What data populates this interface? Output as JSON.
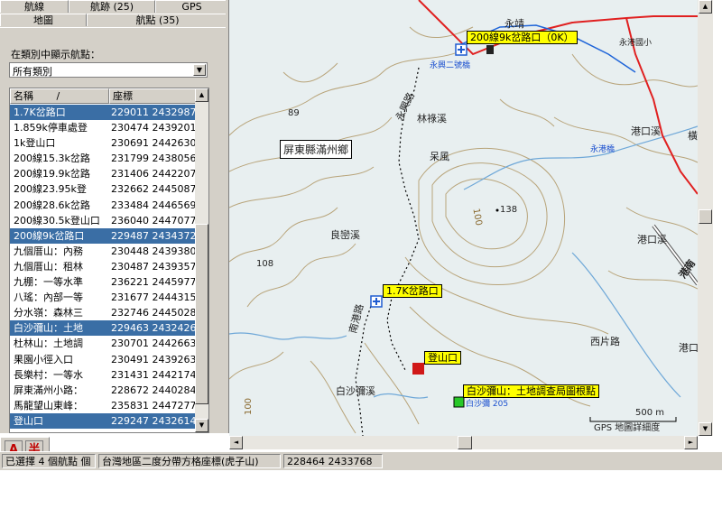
{
  "tabs_row1": [
    "航線",
    "航跡 (25)",
    "GPS"
  ],
  "tabs_row2": [
    "地圖",
    "航點 (35)"
  ],
  "filter": {
    "label": "在類別中顯示航點：",
    "selected": "所有類別"
  },
  "list": {
    "headers": [
      "名稱",
      "座標"
    ],
    "rows": [
      {
        "name": "1.7K岔路口",
        "coord": "229011 2432987",
        "selected": true
      },
      {
        "name": "1.859k停車處登",
        "coord": "230474 2439201",
        "selected": false
      },
      {
        "name": "1k登山口",
        "coord": "230691 2442630",
        "selected": false
      },
      {
        "name": "200線15.3k岔路",
        "coord": "231799 2438056",
        "selected": false
      },
      {
        "name": "200線19.9k岔路",
        "coord": "231406 2442207",
        "selected": false
      },
      {
        "name": "200線23.95k登",
        "coord": "232662 2445087",
        "selected": false
      },
      {
        "name": "200線28.6k岔路",
        "coord": "233484 2446569",
        "selected": false
      },
      {
        "name": "200線30.5k登山口",
        "coord": "236040 2447077",
        "selected": false
      },
      {
        "name": "200線9k岔路口",
        "coord": "229487 2434372",
        "selected": true
      },
      {
        "name": "九個厝山：內務",
        "coord": "230448 2439380",
        "selected": false
      },
      {
        "name": "九個厝山：租林",
        "coord": "230487 2439357",
        "selected": false
      },
      {
        "name": "九棚：一等水準",
        "coord": "236221 2445977",
        "selected": false
      },
      {
        "name": "八瑤：內部一等",
        "coord": "231677 2444315",
        "selected": false
      },
      {
        "name": "分水嶺：森林三",
        "coord": "232746 2445028",
        "selected": false
      },
      {
        "name": "白沙彌山：土地",
        "coord": "229463 2432426",
        "selected": true
      },
      {
        "name": "杜林山：土地調",
        "coord": "230701 2442663",
        "selected": false
      },
      {
        "name": "果園小徑入口",
        "coord": "230491 2439263",
        "selected": false
      },
      {
        "name": "長樂村：一等水",
        "coord": "231431 2442174",
        "selected": false
      },
      {
        "name": "屏東滿州小路：",
        "coord": "228672 2440284",
        "selected": false
      },
      {
        "name": "馬龍望山東峰：",
        "coord": "235831 2447277",
        "selected": false
      },
      {
        "name": "登山口",
        "coord": "229247 2432614",
        "selected": true
      }
    ]
  },
  "map": {
    "labels": {
      "yongjing": "永靖",
      "yongjing_school": "永港國小",
      "yongxing_bridge": "永興二號橋",
      "yonggang_bridge": "永港橋",
      "yongjing_bridge": "永港橋",
      "linxi": "林祿溪",
      "gangkouxi": "港口溪",
      "gangkouxi2": "港口溪",
      "gangkou": "港口",
      "xipian": "西片路",
      "pingdong": "屏東縣滿州鄉",
      "cainfeng": "呆風",
      "liangluanxi": "良巒溪",
      "baisha": "白沙彌溪",
      "yongxing_road": "永興路",
      "nanping_road": "南港路",
      "elev89": "89",
      "elev108": "108",
      "elev138": "138",
      "elev100a": "100",
      "elev100b": "100",
      "bridge205": "白沙彌 205",
      "heng": "橫",
      "gangnan": "港南",
      "scale": "500 m",
      "detail": "GPS 地圖詳細度"
    },
    "waypoints": {
      "w1": "200線9k岔路口（0K）",
      "w2": "1.7K岔路口",
      "w3": "登山口",
      "w4": "白沙彌山：土地調查局圖根點"
    }
  },
  "ime": {
    "mode": "A",
    "width": "半"
  },
  "status": [
    "已選擇 4 個航點 個",
    "台灣地區二度分帶方格座標(虎子山)",
    "228464 2433768"
  ]
}
